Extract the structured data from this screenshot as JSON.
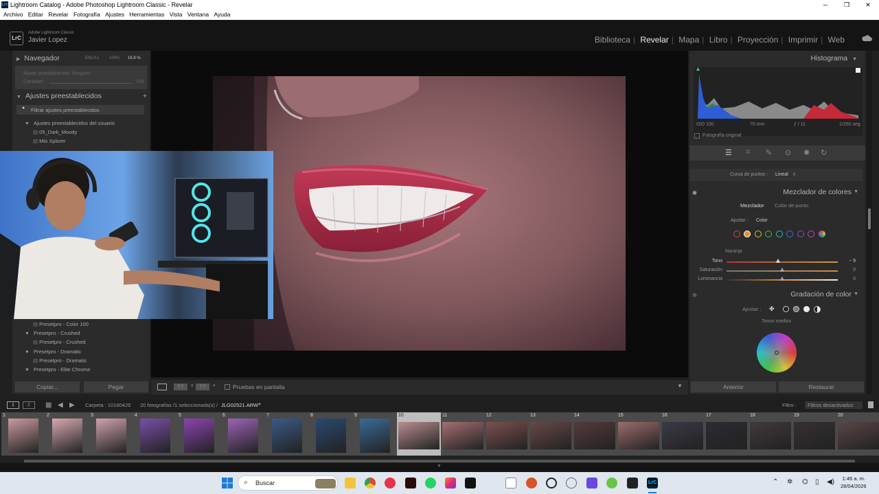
{
  "window": {
    "title": "Lightroom Catalog - Adobe Photoshop Lightroom Classic - Revelar",
    "app_badge": "Lrc",
    "min": "─",
    "max": "❐",
    "close": "✕"
  },
  "menu": [
    "Archivo",
    "Editar",
    "Revelar",
    "Fotografía",
    "Ajustes",
    "Herramientas",
    "Vista",
    "Ventana",
    "Ayuda"
  ],
  "identity": {
    "logo": "LrC",
    "product": "Adobe Lightroom Classic",
    "user": "Javier Lopez"
  },
  "modules": [
    "Biblioteca",
    "Revelar",
    "Mapa",
    "Libro",
    "Proyección",
    "Imprimir",
    "Web"
  ],
  "active_module": "Revelar",
  "left_panel": {
    "navigator": {
      "title": "Navegador",
      "fit": "ENCAJ.",
      "p100": "100%",
      "zoom": "16.8 %"
    },
    "preset_info": {
      "label": "Ajuste preestablecido:",
      "value": "Ninguno",
      "amount_label": "Cantidad",
      "amount_value": "100"
    },
    "presets_title": "Ajustes preestablecidos",
    "filter": "Filtrar ajustes preestablecidos",
    "user_group": "Ajustes preestablecidos del usuario",
    "user_items": [
      "05_Dark_Moody",
      "Mio Xplorer"
    ],
    "lower_items": [
      {
        "type": "item",
        "label": "Presetpro - Color 100"
      },
      {
        "type": "group",
        "label": "Presetpro - Crushed"
      },
      {
        "type": "item",
        "label": "Presetpro - Crushed"
      },
      {
        "type": "group",
        "label": "Presetpro - Dramatic"
      },
      {
        "type": "item",
        "label": "Presetpro - Dramatic"
      },
      {
        "type": "group",
        "label": "Presetpro - Elite Chrome"
      }
    ],
    "copy": "Copiar...",
    "paste": "Pegar"
  },
  "toolbar": {
    "softproof": "Pruebas en pantalla"
  },
  "right_panel": {
    "histogram": {
      "title": "Histograma",
      "iso": "ISO 100",
      "focal": "70 mm",
      "fstop": "ƒ / 11",
      "shutter": "1/250 seg",
      "original": "Fotografía original"
    },
    "curve": {
      "label": "Curva de puntos :",
      "value": "Lineal"
    },
    "mixer": {
      "title": "Mezclador de colores",
      "tab_mixer": "Mezclador",
      "tab_point": "Color de punto",
      "adjust_label": "Ajustar :",
      "adjust_value": "Color",
      "color_name": "Naranja",
      "sliders": [
        {
          "label": "Tono",
          "value": "− 9",
          "pos": 0.46
        },
        {
          "label": "Saturación",
          "value": "0",
          "pos": 0.5
        },
        {
          "label": "Luminancia",
          "value": "0",
          "pos": 0.5
        }
      ],
      "swatches": [
        "#d6404b",
        "#e8912a",
        "#d8c23a",
        "#48b84a",
        "#34b9c0",
        "#3d6fd6",
        "#8a4ad0",
        "#c84ab3"
      ]
    },
    "grading": {
      "title": "Gradación de color",
      "adjust_label": "Ajustar :",
      "midtones": "Tonos medios"
    },
    "prev": "Anterior",
    "reset": "Restaurar"
  },
  "filmstrip": {
    "view1": "1",
    "view2": "2",
    "folder": "Carpeta : 10160425",
    "count": "20 fotografías /1 seleccionada(s) /",
    "file": "JLG02521.ARW",
    "filter_label": "Filtro :",
    "filter_value": "Filtros desactivados",
    "thumbs": [
      "1",
      "2",
      "3",
      "4",
      "5",
      "6",
      "7",
      "8",
      "9",
      "10",
      "11",
      "12",
      "13",
      "14",
      "15",
      "16",
      "17",
      "18",
      "19",
      "20"
    ],
    "selected": "10"
  },
  "taskbar": {
    "search": "Buscar",
    "time": "1:46 a. m.",
    "date": "28/04/2026"
  }
}
